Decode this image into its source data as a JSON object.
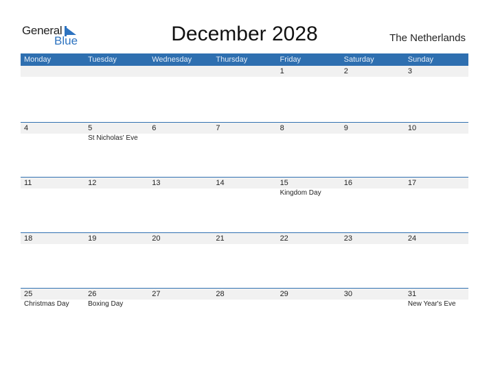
{
  "logo": {
    "word1": "General",
    "word2": "Blue"
  },
  "title": "December 2028",
  "country": "The Netherlands",
  "colors": {
    "accent": "#2e6fb0",
    "strip": "#f1f1f1",
    "logo_blue": "#2d73c0"
  },
  "weekdays": [
    "Monday",
    "Tuesday",
    "Wednesday",
    "Thursday",
    "Friday",
    "Saturday",
    "Sunday"
  ],
  "weeks": [
    {
      "days": [
        {
          "num": "",
          "holiday": ""
        },
        {
          "num": "",
          "holiday": ""
        },
        {
          "num": "",
          "holiday": ""
        },
        {
          "num": "",
          "holiday": ""
        },
        {
          "num": "1",
          "holiday": ""
        },
        {
          "num": "2",
          "holiday": ""
        },
        {
          "num": "3",
          "holiday": ""
        }
      ]
    },
    {
      "days": [
        {
          "num": "4",
          "holiday": ""
        },
        {
          "num": "5",
          "holiday": "St Nicholas' Eve"
        },
        {
          "num": "6",
          "holiday": ""
        },
        {
          "num": "7",
          "holiday": ""
        },
        {
          "num": "8",
          "holiday": ""
        },
        {
          "num": "9",
          "holiday": ""
        },
        {
          "num": "10",
          "holiday": ""
        }
      ]
    },
    {
      "days": [
        {
          "num": "11",
          "holiday": ""
        },
        {
          "num": "12",
          "holiday": ""
        },
        {
          "num": "13",
          "holiday": ""
        },
        {
          "num": "14",
          "holiday": ""
        },
        {
          "num": "15",
          "holiday": "Kingdom Day"
        },
        {
          "num": "16",
          "holiday": ""
        },
        {
          "num": "17",
          "holiday": ""
        }
      ]
    },
    {
      "days": [
        {
          "num": "18",
          "holiday": ""
        },
        {
          "num": "19",
          "holiday": ""
        },
        {
          "num": "20",
          "holiday": ""
        },
        {
          "num": "21",
          "holiday": ""
        },
        {
          "num": "22",
          "holiday": ""
        },
        {
          "num": "23",
          "holiday": ""
        },
        {
          "num": "24",
          "holiday": ""
        }
      ]
    },
    {
      "days": [
        {
          "num": "25",
          "holiday": "Christmas Day"
        },
        {
          "num": "26",
          "holiday": "Boxing Day"
        },
        {
          "num": "27",
          "holiday": ""
        },
        {
          "num": "28",
          "holiday": ""
        },
        {
          "num": "29",
          "holiday": ""
        },
        {
          "num": "30",
          "holiday": ""
        },
        {
          "num": "31",
          "holiday": "New Year's Eve"
        }
      ]
    }
  ]
}
